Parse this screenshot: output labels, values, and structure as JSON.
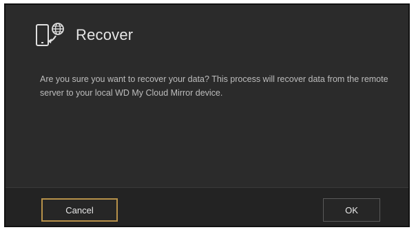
{
  "dialog": {
    "title": "Recover",
    "icon": "device-cloud-recover-icon",
    "message": "Are you sure you want to recover your data? This process will recover data from the remote server to your local WD My Cloud Mirror device.",
    "buttons": {
      "cancel_label": "Cancel",
      "ok_label": "OK"
    },
    "colors": {
      "background": "#2b2b2b",
      "footer": "#232323",
      "focus_border": "#b8924a"
    }
  }
}
